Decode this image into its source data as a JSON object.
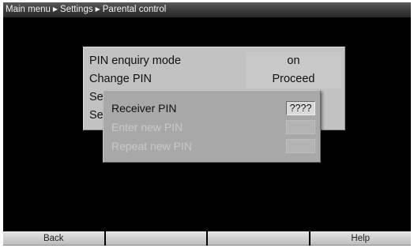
{
  "breadcrumb": {
    "items": [
      "Main menu",
      "Settings",
      "Parental control"
    ]
  },
  "menu": {
    "rows": [
      {
        "label": "PIN enquiry mode",
        "value": "on"
      },
      {
        "label": "Change PIN",
        "value": "Proceed"
      },
      {
        "label": "Se",
        "value": ""
      },
      {
        "label": "Se",
        "value": ""
      }
    ]
  },
  "pin_dialog": {
    "receiver_pin_label": "Receiver PIN",
    "receiver_pin_value": "????",
    "enter_new_label": "Enter new PIN",
    "enter_new_value": "",
    "repeat_new_label": "Repeat new PIN",
    "repeat_new_value": ""
  },
  "footer": {
    "buttons": [
      "Back",
      "",
      "",
      "Help"
    ]
  },
  "colors": {
    "screen_bg": "#000000",
    "panel_bg": "#c2c2c2",
    "dialog_bg": "#a8a8a8",
    "disabled_text": "#c9c9c9"
  }
}
